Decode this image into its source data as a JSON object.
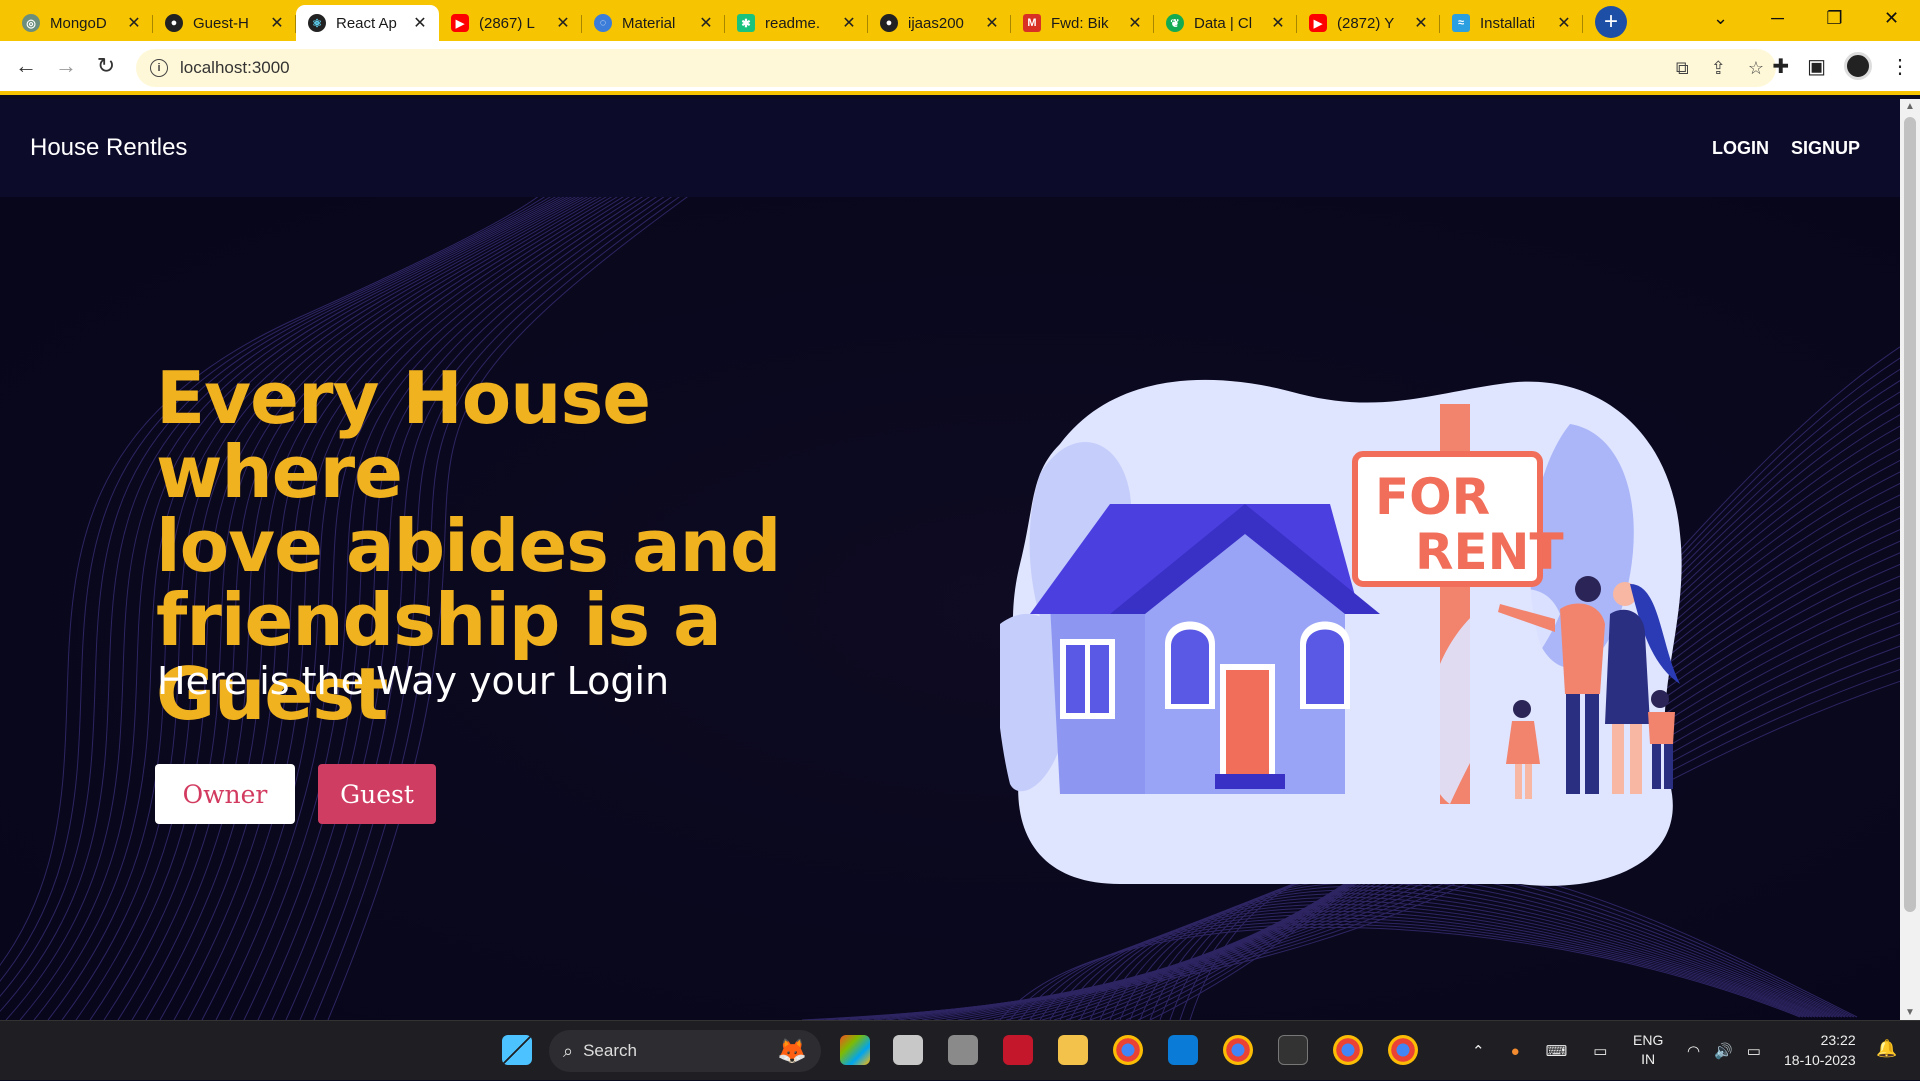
{
  "browser": {
    "tabs": [
      {
        "title": "MongoD",
        "favicon": "mongodb-icon",
        "color": "#3f7f53"
      },
      {
        "title": "Guest-H",
        "favicon": "github-icon",
        "color": "#222222"
      },
      {
        "title": "React Ap",
        "favicon": "react-icon",
        "color": "#1a1a1a",
        "active": true
      },
      {
        "title": "(2867) L",
        "favicon": "youtube-icon",
        "color": "#ff0000"
      },
      {
        "title": "Material",
        "favicon": "material-icon",
        "color": "#3b7dd8"
      },
      {
        "title": "readme.",
        "favicon": "readme-icon",
        "color": "#19c37d"
      },
      {
        "title": "ijaas200",
        "favicon": "github-icon",
        "color": "#222222"
      },
      {
        "title": "Fwd: Bik",
        "favicon": "gmail-icon",
        "color": "#d93025"
      },
      {
        "title": "Data | Cl",
        "favicon": "mongodb-icon",
        "color": "#13aa52"
      },
      {
        "title": "(2872) Y",
        "favicon": "youtube-icon",
        "color": "#ff0000"
      },
      {
        "title": "Installati",
        "favicon": "docs-icon",
        "color": "#2b9fe0"
      }
    ],
    "address": "localhost:3000"
  },
  "site": {
    "brand": "House Rentles",
    "nav": {
      "login": "LOGIN",
      "signup": "SIGNUP"
    },
    "hero": {
      "title_line1": "Every House where",
      "title_line2": "love abides and",
      "title_line3": "friendship is a Guest",
      "subtitle": "Here is the Way your Login",
      "owner_button": "Owner",
      "guest_button": "Guest"
    },
    "sign": {
      "line1": "FOR",
      "line2": "RENT"
    }
  },
  "taskbar": {
    "search_placeholder": "Search",
    "language": {
      "line1": "ENG",
      "line2": "IN"
    },
    "time": "23:22",
    "date": "18-10-2023"
  },
  "colors": {
    "accent": "#f0b21f",
    "guest": "#d03d62",
    "chrome": "#f6c400"
  }
}
